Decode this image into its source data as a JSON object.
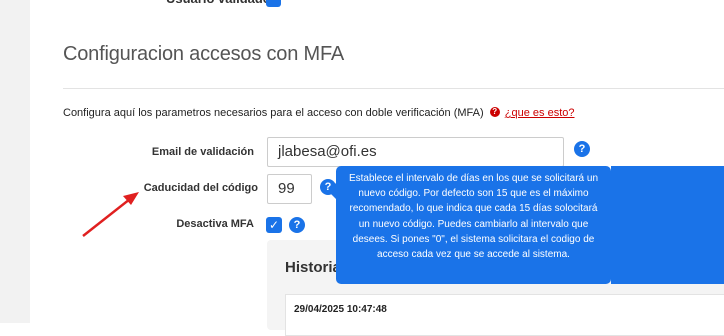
{
  "top": {
    "label": "Usuario validado"
  },
  "section": {
    "title": "Configuracion accesos con MFA"
  },
  "description": {
    "text": "Configura aquí los parametros necesarios para el acceso con doble verificación (MFA)",
    "help_link": "¿que es esto?"
  },
  "form": {
    "email_label": "Email de validación",
    "email_value": "jlabesa@ofi.es",
    "expiry_label": "Caducidad del código",
    "expiry_value": "99",
    "disable_mfa_label": "Desactiva MFA"
  },
  "tooltip": {
    "text": "Establece el intervalo de días en los que se solicitará un nuevo código. Por defecto son 15 que es el máximo recomendado, lo que indica que cada 15 días solocitará un nuevo código. Puedes cambiarlo al intervalo que desees. Si pones \"0\", el sistema solicitara el codigo de acceso cada vez que se accede al sistema."
  },
  "history": {
    "title": "Historial",
    "entries": [
      {
        "date": "29/04/2025 10:47:48"
      }
    ]
  },
  "colors": {
    "accent": "#1a73e8",
    "annotation_arrow": "#e02020",
    "help_red": "#cc0000"
  },
  "icons": [
    "help-circle-icon",
    "checkbox-checked-icon",
    "annotation-arrow"
  ]
}
